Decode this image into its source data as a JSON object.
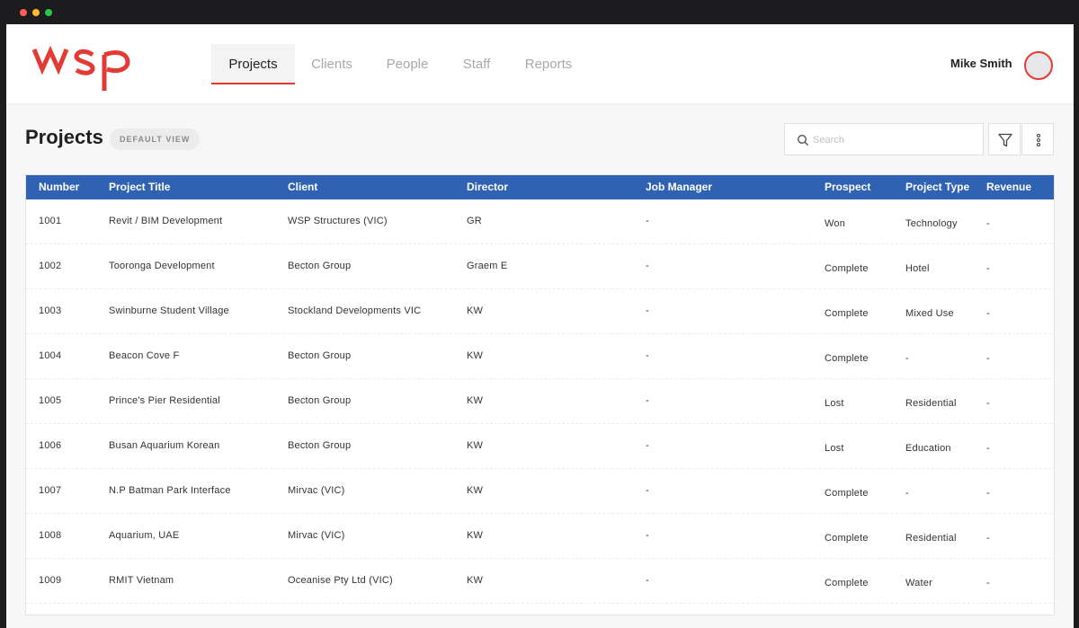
{
  "header": {
    "logo_text": "wsp",
    "nav": [
      {
        "label": "Projects"
      },
      {
        "label": "Clients"
      },
      {
        "label": "People"
      },
      {
        "label": "Staff"
      },
      {
        "label": "Reports"
      }
    ],
    "user_name": "Mike Smith"
  },
  "page": {
    "title": "Projects",
    "view_badge": "DEFAULT VIEW"
  },
  "toolbar": {
    "search_placeholder": "Search",
    "filter_icon": "filter-icon",
    "more_icon": "more-vertical-icon"
  },
  "table": {
    "columns": [
      "Number",
      "Project Title",
      "Client",
      "Director",
      "Job Manager",
      "Prospect",
      "Project Type",
      "Revenue"
    ],
    "rows": [
      {
        "number": "1001",
        "title": "Revit / BIM Development",
        "client": "WSP Structures (VIC)",
        "director": "GR",
        "job_manager": "-",
        "prospect": "Won",
        "project_type": "Technology",
        "revenue": "-"
      },
      {
        "number": "1002",
        "title": "Tooronga Development",
        "client": "Becton Group",
        "director": "Graem E",
        "job_manager": "-",
        "prospect": "Complete",
        "project_type": "Hotel",
        "revenue": "-"
      },
      {
        "number": "1003",
        "title": "Swinburne Student Village",
        "client": "Stockland Developments VIC",
        "director": "KW",
        "job_manager": "-",
        "prospect": "Complete",
        "project_type": "Mixed Use",
        "revenue": "-"
      },
      {
        "number": "1004",
        "title": "Beacon Cove F",
        "client": "Becton Group",
        "director": "KW",
        "job_manager": "-",
        "prospect": "Complete",
        "project_type": "-",
        "revenue": "-"
      },
      {
        "number": "1005",
        "title": "Prince's Pier Residential",
        "client": "Becton Group",
        "director": "KW",
        "job_manager": "-",
        "prospect": "Lost",
        "project_type": "Residential",
        "revenue": "-"
      },
      {
        "number": "1006",
        "title": "Busan Aquarium Korean",
        "client": "Becton Group",
        "director": "KW",
        "job_manager": "-",
        "prospect": "Lost",
        "project_type": "Education",
        "revenue": "-"
      },
      {
        "number": "1007",
        "title": "N.P Batman Park Interface",
        "client": "Mirvac (VIC)",
        "director": "KW",
        "job_manager": "-",
        "prospect": "Complete",
        "project_type": "-",
        "revenue": "-"
      },
      {
        "number": "1008",
        "title": "Aquarium, UAE",
        "client": "Mirvac (VIC)",
        "director": "KW",
        "job_manager": "-",
        "prospect": "Complete",
        "project_type": "Residential",
        "revenue": "-"
      },
      {
        "number": "1009",
        "title": "RMIT Vietnam",
        "client": "Oceanise Pty Ltd (VIC)",
        "director": "KW",
        "job_manager": "-",
        "prospect": "Complete",
        "project_type": "Water",
        "revenue": "-"
      }
    ]
  },
  "colors": {
    "accent": "#e33a35",
    "table_header": "#2f62b3"
  }
}
